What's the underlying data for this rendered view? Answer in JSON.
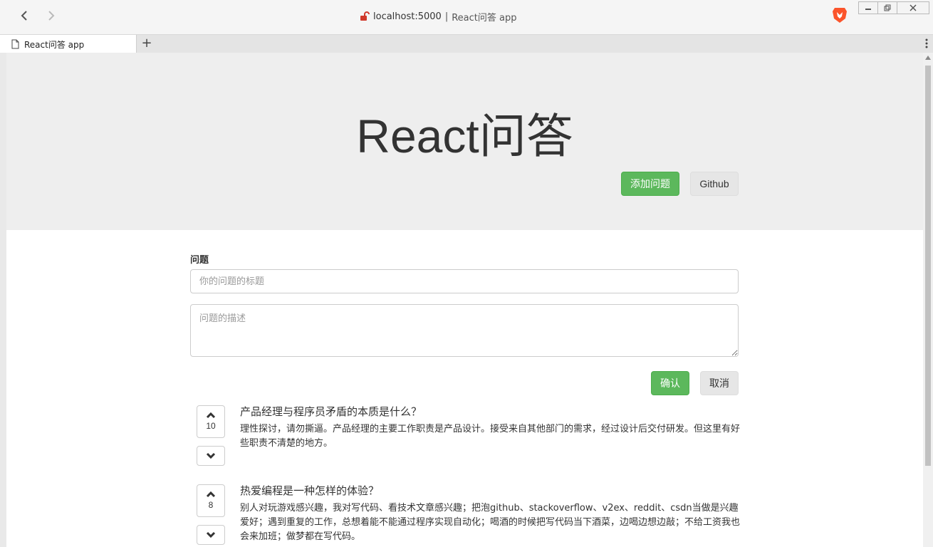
{
  "browser": {
    "url_host": "localhost:5000",
    "url_sep": "|",
    "page_title": "React问答 app",
    "tab_title": "React问答 app",
    "new_tab_symbol": "+"
  },
  "header": {
    "title": "React问答",
    "add_button": "添加问题",
    "github_button": "Github"
  },
  "form": {
    "label": "问题",
    "title_placeholder": "你的问题的标题",
    "desc_placeholder": "问题的描述",
    "confirm": "确认",
    "cancel": "取消"
  },
  "questions": [
    {
      "votes": "10",
      "title": "产品经理与程序员矛盾的本质是什么？",
      "desc": "理性探讨，请勿撕逼。产品经理的主要工作职责是产品设计。接受来自其他部门的需求，经过设计后交付研发。但这里有好些职责不清楚的地方。"
    },
    {
      "votes": "8",
      "title": "热爱编程是一种怎样的体验？",
      "desc": "别人对玩游戏感兴趣，我对写代码、看技术文章感兴趣；把泡github、stackoverflow、v2ex、reddit、csdn当做是兴趣爱好；遇到重复的工作，总想着能不能通过程序实现自动化；喝酒的时候把写代码当下酒菜，边喝边想边敲；不给工资我也会来加班；做梦都在写代码。"
    }
  ],
  "icons": {
    "lock": "lock-icon",
    "brave": "brave-lion-icon",
    "up": "chevron-up-icon",
    "down": "chevron-down-icon"
  },
  "colors": {
    "success": "#5cb85c",
    "jumbotron": "#eeeeee",
    "lock": "#d0392b",
    "brave": "#fb542b"
  }
}
